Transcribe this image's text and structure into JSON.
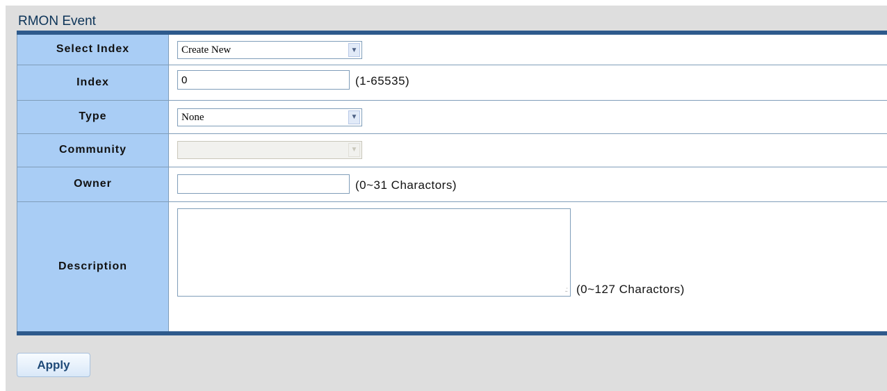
{
  "page": {
    "title": "RMON Event"
  },
  "form": {
    "select_index": {
      "label": "Select Index",
      "value": "Create New"
    },
    "index": {
      "label": "Index",
      "value": "0",
      "hint": "(1-65535)"
    },
    "type": {
      "label": "Type",
      "value": "None"
    },
    "community": {
      "label": "Community",
      "value": ""
    },
    "owner": {
      "label": "Owner",
      "value": "",
      "hint": "(0~31 Charactors)"
    },
    "description": {
      "label": "Description",
      "value": "",
      "hint": "(0~127 Charactors)"
    }
  },
  "actions": {
    "apply_label": "Apply"
  },
  "icons": {
    "dropdown": "chevron-down-icon",
    "resize": "resize-grip-icon"
  },
  "colors": {
    "label_bg": "#a9cdf5",
    "border_accent": "#2e5a8c",
    "title": "#0d3458"
  }
}
